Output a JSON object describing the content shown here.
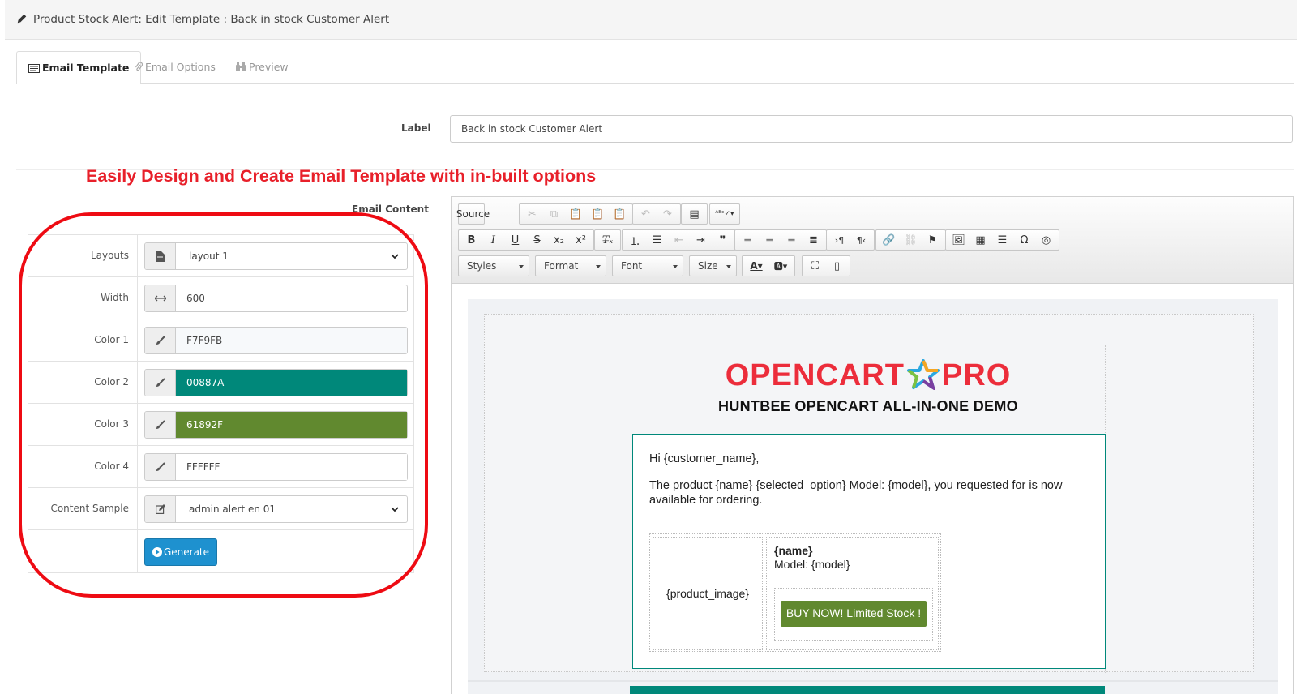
{
  "header": {
    "title": "Product Stock Alert: Edit Template : Back in stock Customer Alert"
  },
  "tabs": [
    {
      "label": "Email Template",
      "active": true
    },
    {
      "label": "Email Options",
      "active": false
    },
    {
      "label": "Preview",
      "active": false
    }
  ],
  "label_field": {
    "label": "Label",
    "value": "Back in stock Customer Alert"
  },
  "headline": "Easily Design and Create Email Template with in-built options",
  "email_content_label": "Email Content",
  "options": {
    "layouts": {
      "label": "Layouts",
      "value": "layout 1"
    },
    "width": {
      "label": "Width",
      "value": "600"
    },
    "color1": {
      "label": "Color 1",
      "value": "F7F9FB"
    },
    "color2": {
      "label": "Color 2",
      "value": "00887A"
    },
    "color3": {
      "label": "Color 3",
      "value": "61892F"
    },
    "color4": {
      "label": "Color 4",
      "value": "FFFFFF"
    },
    "content_sample": {
      "label": "Content Sample",
      "value": "admin alert en 01"
    },
    "generate_label": "Generate"
  },
  "toolbar": {
    "source_label": "Source",
    "styles": "Styles",
    "format": "Format",
    "font": "Font",
    "size": "Size"
  },
  "email": {
    "logo_left": "OPENCART",
    "logo_right": "PRO",
    "tagline": "HUNTBEE OPENCART ALL-IN-ONE DEMO",
    "greeting": "Hi {customer_name},",
    "message": "The product {name} {selected_option} Model: {model}, you requested for is now available for ordering.",
    "product_image": "{product_image}",
    "product_name": "{name}",
    "product_model": "Model: {model}",
    "buy_button": "BUY NOW! Limited Stock !"
  },
  "colors": {
    "accent_teal": "#00887a",
    "accent_green": "#61892f",
    "highlight_red": "#ee0b13",
    "button_blue": "#1e91cf",
    "logo_red": "#ec2d3b"
  }
}
